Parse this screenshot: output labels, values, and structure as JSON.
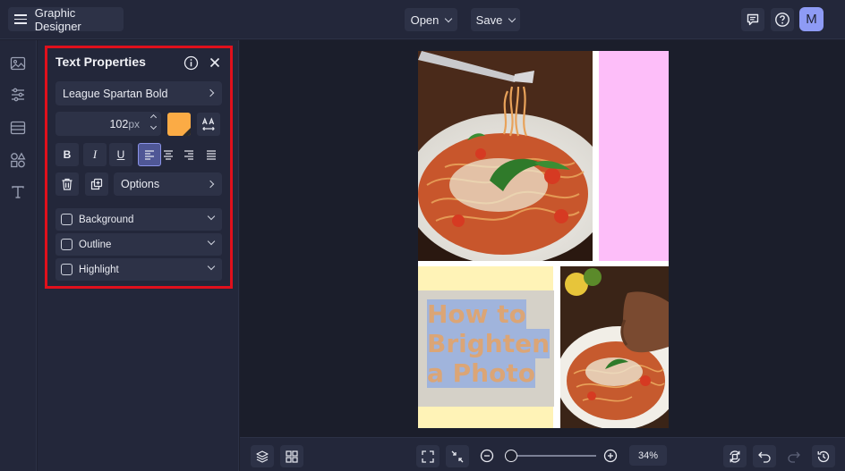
{
  "header": {
    "app_title": "Graphic Designer",
    "open_label": "Open",
    "save_label": "Save",
    "avatar_initial": "M"
  },
  "text_properties": {
    "title": "Text Properties",
    "font_name": "League Spartan Bold",
    "font_size": "102",
    "font_unit": "px",
    "text_color": "#fbab45",
    "bold_label": "B",
    "italic_label": "I",
    "underline_label": "U",
    "options_label": "Options",
    "toggles": [
      {
        "label": "Background",
        "checked": false
      },
      {
        "label": "Outline",
        "checked": false
      },
      {
        "label": "Highlight",
        "checked": false
      }
    ]
  },
  "canvas": {
    "headline_lines": [
      "How to",
      "Brighten",
      "a Photo"
    ],
    "headline_color": "#dba576",
    "highlight_color": "#a0b4dc",
    "pink_block_color": "#fdbef9",
    "yellow_block_color": "#fff3b7"
  },
  "zoom": {
    "value_label": "34%",
    "level_fraction": 0.05
  },
  "colors": {
    "accent": "#8e9bf5",
    "selection_border": "#e0101c"
  }
}
